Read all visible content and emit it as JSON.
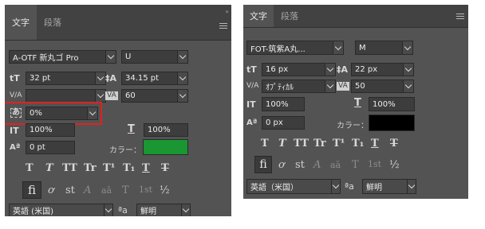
{
  "left_panel": {
    "tabs": [
      "文字",
      "段落"
    ],
    "font_family": "A-OTF 新丸ゴ Pro",
    "font_style": "U",
    "font_size": "32 pt",
    "leading": "34.15 pt",
    "kerning": "",
    "tracking": "60",
    "tsume": "0%",
    "vertical_scale": "100%",
    "horizontal_scale": "100%",
    "baseline_shift": "0 pt",
    "color_label": "カラー：",
    "color_swatch": "#1a9632",
    "style_buttons": [
      "T",
      "T",
      "TT",
      "Tr",
      "T¹",
      "T₁",
      "T",
      "T"
    ],
    "opentype_buttons": [
      "fi",
      "ơ",
      "st",
      "A",
      "aā",
      "T",
      "1st",
      "½"
    ],
    "language": "英語 (米国)",
    "aa_label": "ªa",
    "antialias": "鮮明"
  },
  "right_panel": {
    "tabs": [
      "文字",
      "段落"
    ],
    "font_family": "FOT-筑紫A丸...",
    "font_style": "M",
    "font_size": "16 px",
    "leading": "22 px",
    "kerning": "ｵﾌﾟﾃｨｶﾙ",
    "tracking": "50",
    "vertical_scale": "100%",
    "horizontal_scale": "100%",
    "baseline_shift": "0 px",
    "color_label": "カラー：",
    "color_swatch": "#000000",
    "style_buttons": [
      "T",
      "T",
      "TT",
      "Tr",
      "T¹",
      "T₁",
      "T",
      "T"
    ],
    "opentype_buttons": [
      "fi",
      "ơ",
      "st",
      "A",
      "aā",
      "T",
      "1st",
      "½"
    ],
    "language": "英語（米国）",
    "aa_label": "ªa",
    "antialias": "鮮明"
  },
  "icons": {
    "size": "tT",
    "leading": "‡A",
    "kerning": "V/A",
    "tracking": "VA",
    "tsume": "あ",
    "vscale": "IT",
    "hscale": "T",
    "baseline": "Aª"
  },
  "highlight_color": "#e22020"
}
